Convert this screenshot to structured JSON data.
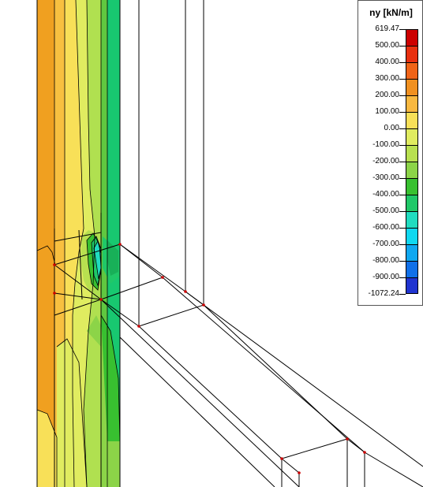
{
  "legend": {
    "title": "ny [kN/m]",
    "labels": [
      "619.47",
      "500.00",
      "400.00",
      "300.00",
      "200.00",
      "100.00",
      "0.00",
      "-100.00",
      "-200.00",
      "-300.00",
      "-400.00",
      "-500.00",
      "-600.00",
      "-700.00",
      "-800.00",
      "-900.00",
      "-1072.24"
    ],
    "colors": [
      "#cc0000",
      "#e83010",
      "#f06418",
      "#f09020",
      "#f8b840",
      "#f8e058",
      "#e0ec60",
      "#b8e050",
      "#8cd448",
      "#38c030",
      "#20c868",
      "#20dcc0",
      "#10d8f0",
      "#10a8f0",
      "#1070e8",
      "#2034d0",
      "#4818c0"
    ]
  }
}
